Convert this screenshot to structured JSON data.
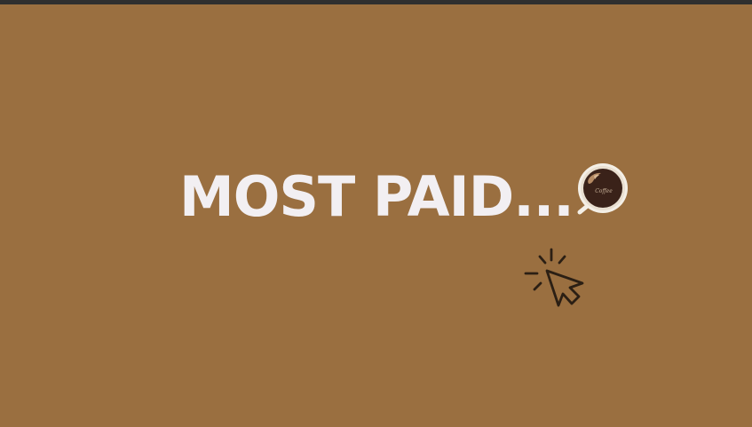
{
  "slide": {
    "headline": "MOST PAID...",
    "cup_text": "Coffee"
  },
  "colors": {
    "background": "#9a6f40",
    "headline": "#f2eff2",
    "coffee": "#3a2219",
    "cursor": "#2b1f14"
  },
  "icons": {
    "coffee_cup": "coffee-cup-icon",
    "cursor": "click-cursor-icon"
  }
}
